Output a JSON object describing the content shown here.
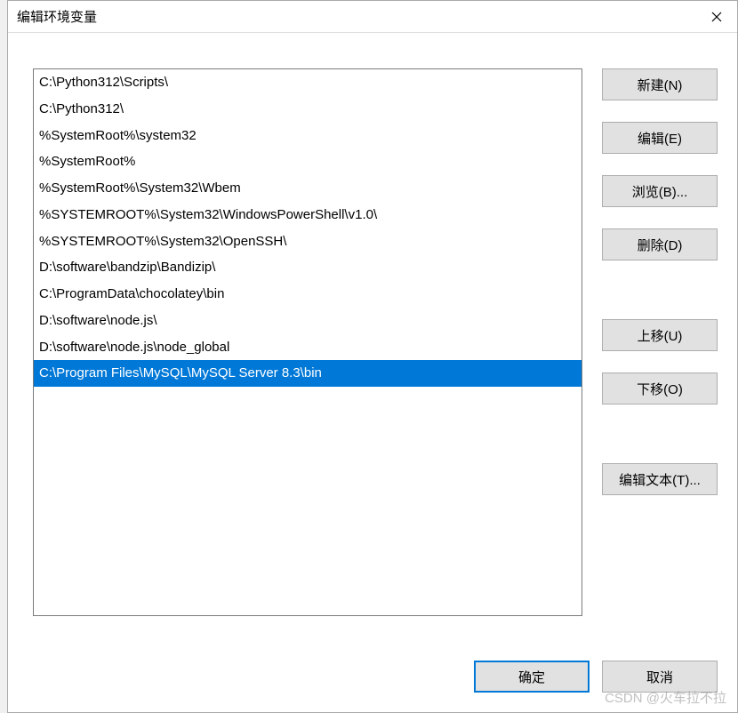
{
  "title": "编辑环境变量",
  "list": {
    "items": [
      "C:\\Python312\\Scripts\\",
      "C:\\Python312\\",
      "%SystemRoot%\\system32",
      "%SystemRoot%",
      "%SystemRoot%\\System32\\Wbem",
      "%SYSTEMROOT%\\System32\\WindowsPowerShell\\v1.0\\",
      "%SYSTEMROOT%\\System32\\OpenSSH\\",
      "D:\\software\\bandzip\\Bandizip\\",
      "C:\\ProgramData\\chocolatey\\bin",
      "D:\\software\\node.js\\",
      "D:\\software\\node.js\\node_global",
      "C:\\Program Files\\MySQL\\MySQL Server 8.3\\bin"
    ],
    "selected_index": 11
  },
  "buttons": {
    "new": "新建(N)",
    "edit": "编辑(E)",
    "browse": "浏览(B)...",
    "delete": "删除(D)",
    "move_up": "上移(U)",
    "move_down": "下移(O)",
    "edit_text": "编辑文本(T)...",
    "ok": "确定",
    "cancel": "取消"
  },
  "watermark": "CSDN @火车拉不拉"
}
